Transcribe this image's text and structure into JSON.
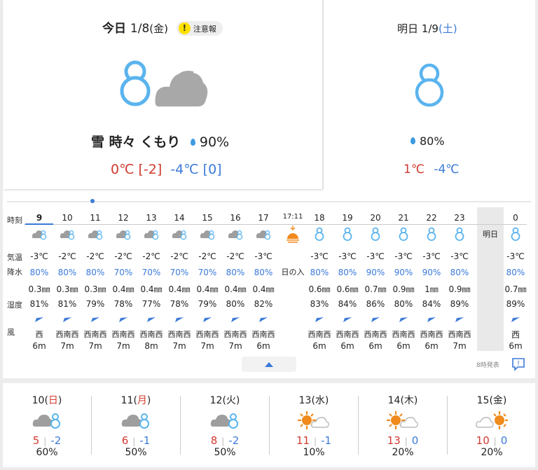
{
  "today": {
    "label": "今日",
    "date": "1/8",
    "weekday": "(金)",
    "warning_label": "注意報",
    "weather": "雪 時々 くもり",
    "precip": "90%",
    "high": "0℃",
    "high_diff": "[-2]",
    "low": "-4℃",
    "low_diff": "[0]"
  },
  "tomorrow": {
    "label": "明日",
    "date": "1/9",
    "weekday": "(土)",
    "precip": "80%",
    "high": "1℃",
    "low": "-4℃"
  },
  "hourly": {
    "row_labels": {
      "time": "時刻",
      "temp": "気温",
      "precip": "降水",
      "humidity": "湿度",
      "wind": "風"
    },
    "hours": [
      {
        "time": "9",
        "icon": "snow-cloud-icon",
        "temp": "-3℃",
        "pop": "80%",
        "mm": "0.3㎜",
        "hum": "81%",
        "dir": "西",
        "speed": "6m"
      },
      {
        "time": "10",
        "icon": "snow-cloud-icon",
        "temp": "-2℃",
        "pop": "80%",
        "mm": "0.3㎜",
        "hum": "81%",
        "dir": "西南西",
        "speed": "7m"
      },
      {
        "time": "11",
        "icon": "snow-cloud-icon",
        "temp": "-2℃",
        "pop": "80%",
        "mm": "0.3㎜",
        "hum": "79%",
        "dir": "西南西",
        "speed": "7m"
      },
      {
        "time": "12",
        "icon": "snow-cloud-icon",
        "temp": "-2℃",
        "pop": "70%",
        "mm": "0.4㎜",
        "hum": "78%",
        "dir": "西南西",
        "speed": "7m"
      },
      {
        "time": "13",
        "icon": "snow-cloud-icon",
        "temp": "-2℃",
        "pop": "70%",
        "mm": "0.4㎜",
        "hum": "77%",
        "dir": "西南西",
        "speed": "8m"
      },
      {
        "time": "14",
        "icon": "snow-cloud-icon",
        "temp": "-2℃",
        "pop": "70%",
        "mm": "0.4㎜",
        "hum": "78%",
        "dir": "西南西",
        "speed": "7m"
      },
      {
        "time": "15",
        "icon": "snow-cloud-icon",
        "temp": "-2℃",
        "pop": "70%",
        "mm": "0.4㎜",
        "hum": "79%",
        "dir": "西南西",
        "speed": "7m"
      },
      {
        "time": "16",
        "icon": "snow-cloud-icon",
        "temp": "-2℃",
        "pop": "80%",
        "mm": "0.4㎜",
        "hum": "80%",
        "dir": "西南西",
        "speed": "7m"
      },
      {
        "time": "17",
        "icon": "snow-cloud-icon",
        "temp": "-3℃",
        "pop": "80%",
        "mm": "0.4㎜",
        "hum": "82%",
        "dir": "西南西",
        "speed": "6m"
      },
      {
        "time": "17:11",
        "icon": "sunset-icon",
        "temp": "",
        "pop": "",
        "mm": "",
        "hum": "",
        "dir": "",
        "speed": "",
        "event": "日の入"
      },
      {
        "time": "18",
        "icon": "snowman-icon",
        "temp": "-3℃",
        "pop": "80%",
        "mm": "0.6㎜",
        "hum": "83%",
        "dir": "西南西",
        "speed": "6m"
      },
      {
        "time": "19",
        "icon": "snowman-icon",
        "temp": "-3℃",
        "pop": "80%",
        "mm": "0.6㎜",
        "hum": "84%",
        "dir": "西南西",
        "speed": "6m"
      },
      {
        "time": "20",
        "icon": "snowman-icon",
        "temp": "-3℃",
        "pop": "90%",
        "mm": "0.7㎜",
        "hum": "86%",
        "dir": "西南西",
        "speed": "6m"
      },
      {
        "time": "21",
        "icon": "snowman-icon",
        "temp": "-3℃",
        "pop": "90%",
        "mm": "0.9㎜",
        "hum": "80%",
        "dir": "西南西",
        "speed": "6m"
      },
      {
        "time": "22",
        "icon": "snowman-icon",
        "temp": "-3℃",
        "pop": "90%",
        "mm": "1㎜",
        "hum": "84%",
        "dir": "西南西",
        "speed": "6m"
      },
      {
        "time": "23",
        "icon": "snowman-icon",
        "temp": "-3℃",
        "pop": "80%",
        "mm": "0.9㎜",
        "hum": "89%",
        "dir": "西南西",
        "speed": "7m"
      }
    ],
    "tomorrow_label": "明日",
    "next": {
      "time": "0",
      "icon": "snowman-icon",
      "temp": "-3℃",
      "pop": "80%",
      "mm": "0.7㎜",
      "hum": "89%",
      "dir": "西",
      "speed": "6m"
    },
    "issued": "8時発表"
  },
  "weekly": [
    {
      "day": "10",
      "wd": "日",
      "high": "5",
      "low": "-2",
      "pop": "60%",
      "icon": "cloud-snowman-icon",
      "wd_color": "#d03a2f"
    },
    {
      "day": "11",
      "wd": "月",
      "high": "6",
      "low": "-1",
      "pop": "50%",
      "icon": "cloud-snowman-icon",
      "wd_color": "#d03a2f"
    },
    {
      "day": "12",
      "wd": "火",
      "high": "8",
      "low": "-2",
      "pop": "50%",
      "icon": "cloud-snowman-icon",
      "wd_color": "#222222"
    },
    {
      "day": "13",
      "wd": "水",
      "high": "11",
      "low": "-1",
      "pop": "10%",
      "icon": "sun-cloud-icon",
      "wd_color": "#222222"
    },
    {
      "day": "14",
      "wd": "木",
      "high": "13",
      "low": "0",
      "pop": "20%",
      "icon": "sun-cloud-icon",
      "wd_color": "#222222"
    },
    {
      "day": "15",
      "wd": "金",
      "high": "10",
      "low": "0",
      "pop": "20%",
      "icon": "cloud-sun-icon",
      "wd_color": "#222222"
    }
  ],
  "colors": {
    "high": "#d03a2f",
    "low": "#3b7ad8",
    "snow": "#5ab4ee",
    "cloud": "#9e9e9e",
    "sun": "#f08a1c"
  }
}
